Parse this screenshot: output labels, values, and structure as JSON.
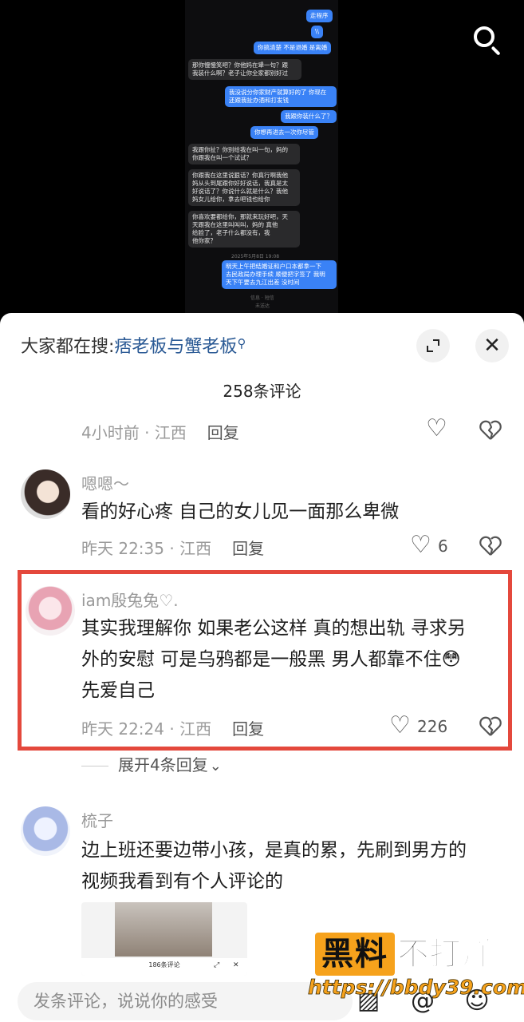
{
  "video": {
    "chat_messages": [
      {
        "side": "right",
        "text": "走程序"
      },
      {
        "side": "right",
        "text": "\\\\"
      },
      {
        "side": "right",
        "text": "你搞清楚 不是退婚 是离婚"
      },
      {
        "side": "left",
        "text": "那你慢慢笑吧？你他妈在犟一句？跟\n我装什么啊？老子让你全家都别好过"
      },
      {
        "side": "right",
        "text": "我没说分你家财产就算好的了 你现在\n还跟我扯办酒和打发钱"
      },
      {
        "side": "right",
        "text": "我跟你装什么了？"
      },
      {
        "side": "right",
        "text": "你想再进去一次你尽管"
      },
      {
        "side": "left",
        "text": "我跟你扯？你别给我在叫一句，妈的\n你跟我在叫一个试试？"
      },
      {
        "side": "left",
        "text": "你跟我在这里说狠话？你真行啊我他\n妈从头到尾跟你好好说话，我真是太\n好说话了？你说什么就是什么？我他\n妈女儿给你，拿去吧钱也给你"
      },
      {
        "side": "left",
        "text": "你喜欢要都给你，那就来玩好吧，天\n天跟我在这里叫叫叫，妈的      真他\n   给脸了，老子什么都没有，我\n他你家？"
      },
      {
        "side": "right",
        "text": "明天上午把结婚证和户口本都拿一下\n去民政局办理手续 顺便把字签了 我明\n天下午要去九江出差 没时间"
      }
    ],
    "chat_timestamp": "2025年5月8日 19:08",
    "chat_footer": [
      "信息 · 短信",
      "未送达"
    ]
  },
  "sheet": {
    "search_hint_prefix": "大家都在搜:",
    "search_hint_keyword": "痞老板与蟹老板",
    "search_hint_icon": "search-icon",
    "expand_icon": "expand-icon",
    "close_label": "✕",
    "comment_count": "258条评论"
  },
  "top_meta": {
    "time": "4小时前 · 江西",
    "reply": "回复"
  },
  "comments": [
    {
      "username": "嗯嗯～",
      "text": "看的好心疼 自己的女儿见一面那么卑微",
      "time": "昨天 22:35 · 江西",
      "reply": "回复",
      "likes": "6"
    },
    {
      "username": "iam殷兔兔♡.",
      "text_lines": [
        "其实我理解你 如果老公这样 真的想出轨 寻求另",
        "外的安慰 可是乌鸦都是一般黑 男人都靠不住😳",
        "先爱自己"
      ],
      "time": "昨天 22:24 · 江西",
      "reply": "回复",
      "likes": "226",
      "expand_replies": "展开4条回复"
    },
    {
      "username": "梳子",
      "text_lines": [
        "边上班还要边带小孩，是真的累，先刷到男方的",
        "视频我看到有个人评论的"
      ],
      "thumb_caption": "186条评论"
    }
  ],
  "watermark": {
    "logo": "黑料",
    "text": "不打烊",
    "url": "https://bbdy39.com"
  },
  "input": {
    "placeholder": "发条评论，说说你的感受"
  },
  "colors": {
    "accent_link": "#2b5a95",
    "highlight_border": "#e4483c",
    "watermark_orange": "#f6a21c",
    "chat_blue": "#3a82f6"
  }
}
